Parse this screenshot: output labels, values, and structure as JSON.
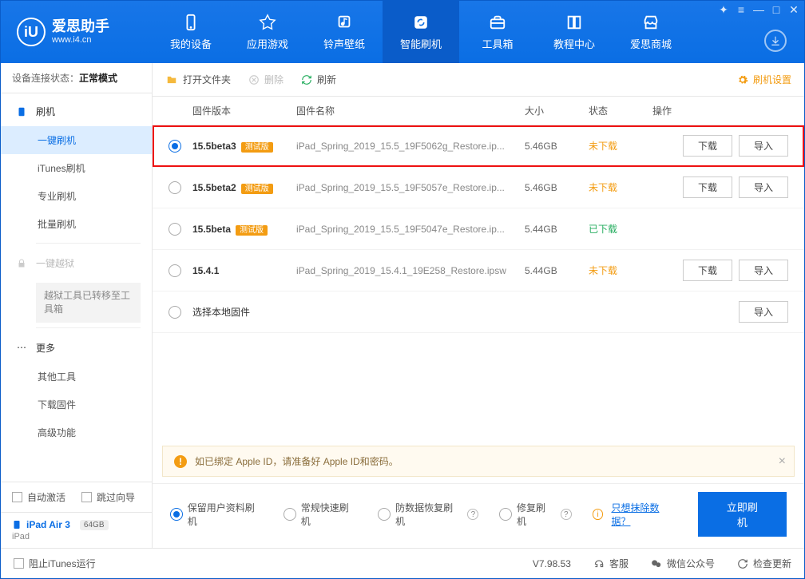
{
  "logo": {
    "main": "爱思助手",
    "sub": "www.i4.cn",
    "letter": "iU"
  },
  "nav": [
    {
      "label": "我的设备",
      "icon": "device"
    },
    {
      "label": "应用游戏",
      "icon": "apps"
    },
    {
      "label": "铃声壁纸",
      "icon": "music"
    },
    {
      "label": "智能刷机",
      "icon": "refresh",
      "active": true
    },
    {
      "label": "工具箱",
      "icon": "toolbox"
    },
    {
      "label": "教程中心",
      "icon": "book"
    },
    {
      "label": "爱思商城",
      "icon": "shop"
    }
  ],
  "sidebar": {
    "conn_prefix": "设备连接状态：",
    "conn_status": "正常模式",
    "flash_head": "刷机",
    "items": [
      "一键刷机",
      "iTunes刷机",
      "专业刷机",
      "批量刷机"
    ],
    "jailbreak": "一键越狱",
    "jailbreak_note": "越狱工具已转移至工具箱",
    "more_head": "更多",
    "more_items": [
      "其他工具",
      "下载固件",
      "高级功能"
    ],
    "auto_activate": "自动激活",
    "skip_guide": "跳过向导",
    "device_name": "iPad Air 3",
    "storage": "64GB",
    "device_type": "iPad"
  },
  "toolbar": {
    "open": "打开文件夹",
    "delete": "删除",
    "refresh": "刷新",
    "settings": "刷机设置"
  },
  "table": {
    "headers": {
      "version": "固件版本",
      "name": "固件名称",
      "size": "大小",
      "status": "状态",
      "action": "操作"
    },
    "rows": [
      {
        "selected": true,
        "version": "15.5beta3",
        "beta": "测试版",
        "name": "iPad_Spring_2019_15.5_19F5062g_Restore.ip...",
        "size": "5.46GB",
        "status": "未下载",
        "status_kind": "no",
        "download": true,
        "import": true,
        "highlight": true
      },
      {
        "selected": false,
        "version": "15.5beta2",
        "beta": "测试版",
        "name": "iPad_Spring_2019_15.5_19F5057e_Restore.ip...",
        "size": "5.46GB",
        "status": "未下载",
        "status_kind": "no",
        "download": true,
        "import": true
      },
      {
        "selected": false,
        "version": "15.5beta",
        "beta": "测试版",
        "name": "iPad_Spring_2019_15.5_19F5047e_Restore.ip...",
        "size": "5.44GB",
        "status": "已下载",
        "status_kind": "yes",
        "download": false,
        "import": false
      },
      {
        "selected": false,
        "version": "15.4.1",
        "beta": null,
        "name": "iPad_Spring_2019_15.4.1_19E258_Restore.ipsw",
        "size": "5.44GB",
        "status": "未下载",
        "status_kind": "no",
        "download": true,
        "import": true
      },
      {
        "selected": false,
        "version": "选择本地固件",
        "local": true,
        "import": true
      }
    ],
    "btn_download": "下载",
    "btn_import": "导入"
  },
  "alert": "如已绑定 Apple ID，请准备好 Apple ID和密码。",
  "options": {
    "keep": "保留用户资料刷机",
    "normal": "常规快速刷机",
    "antidata": "防数据恢复刷机",
    "repair": "修复刷机",
    "erase": "只想抹除数据？",
    "flash_btn": "立即刷机"
  },
  "footer": {
    "block_itunes": "阻止iTunes运行",
    "version": "V7.98.53",
    "support": "客服",
    "wechat": "微信公众号",
    "update": "检查更新"
  }
}
